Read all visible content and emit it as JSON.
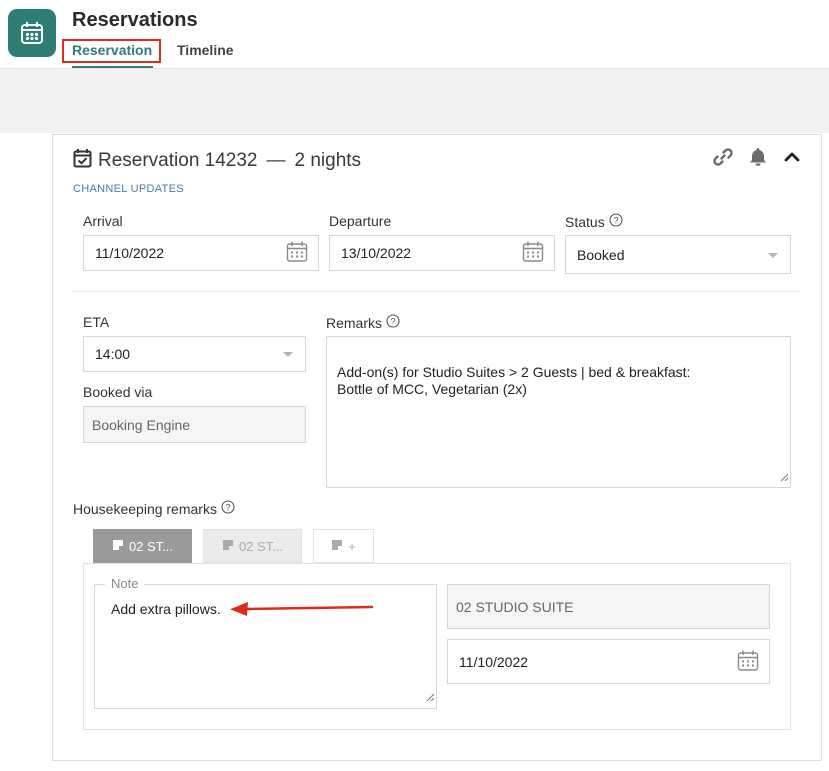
{
  "app": {
    "title": "Reservations",
    "tabs": [
      {
        "label": "Reservation",
        "active": true
      },
      {
        "label": "Timeline",
        "active": false
      }
    ],
    "accent_color": "#2e7d74",
    "highlight_color": "#e02a1b"
  },
  "reservation": {
    "title": "Reservation 14232",
    "separator": "—",
    "nights": "2 nights",
    "channel_updates": "CHANNEL UPDATES",
    "header_icons": [
      "link-icon",
      "bell-icon",
      "chevron-up-icon"
    ],
    "arrival": {
      "label": "Arrival",
      "value": "11/10/2022"
    },
    "departure": {
      "label": "Departure",
      "value": "13/10/2022"
    },
    "status": {
      "label": "Status",
      "value": "Booked"
    },
    "eta": {
      "label": "ETA",
      "value": "14:00"
    },
    "booked_via": {
      "label": "Booked via",
      "value": "Booking Engine"
    },
    "remarks": {
      "label": "Remarks",
      "value": "Add-on(s) for Studio Suites > 2 Guests | bed & breakfast:\nBottle of MCC, Vegetarian (2x)"
    }
  },
  "housekeeping": {
    "label": "Housekeeping remarks",
    "tabs": [
      {
        "label": "02 ST...",
        "active": true
      },
      {
        "label": "02 ST...",
        "active": false
      },
      {
        "label": "+",
        "active": false
      }
    ],
    "note_legend": "Note",
    "note_text": "Add extra pillows.",
    "room": "02 STUDIO SUITE",
    "date": "11/10/2022"
  }
}
